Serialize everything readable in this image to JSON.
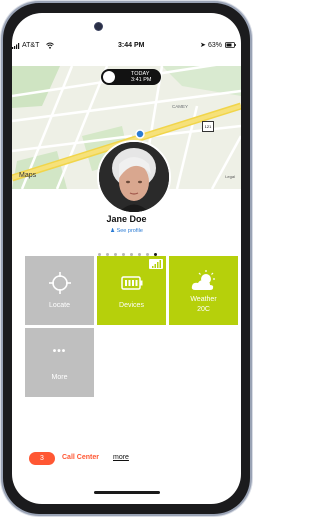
{
  "status_bar": {
    "carrier": "AT&T",
    "time": "3:44 PM",
    "battery": "63%"
  },
  "map": {
    "timestamp_line1": "TODAY",
    "timestamp_line2": "3:41 PM",
    "attribution": "Maps",
    "legal": "Legal",
    "area_label": "CAMEY",
    "route_shield": "121"
  },
  "profile": {
    "name": "Jane Doe",
    "see_profile": "See profile"
  },
  "page_dots": {
    "count": 8,
    "active": 8
  },
  "tiles": [
    {
      "label": "Locate",
      "color": "#bfbfbf"
    },
    {
      "label": "Devices",
      "color": "#b6d00b"
    },
    {
      "label_line1": "Weather",
      "label_line2": "20C",
      "color": "#b6d00b"
    },
    {
      "label": "More",
      "color": "#bfbfbf"
    }
  ],
  "call_center": {
    "count": "3",
    "label": "Call Center",
    "more": "more"
  },
  "colors": {
    "accent_orange": "#ff5733",
    "tile_green": "#b6d00b",
    "tile_grey": "#bfbfbf",
    "link_blue": "#2a7bd4"
  }
}
